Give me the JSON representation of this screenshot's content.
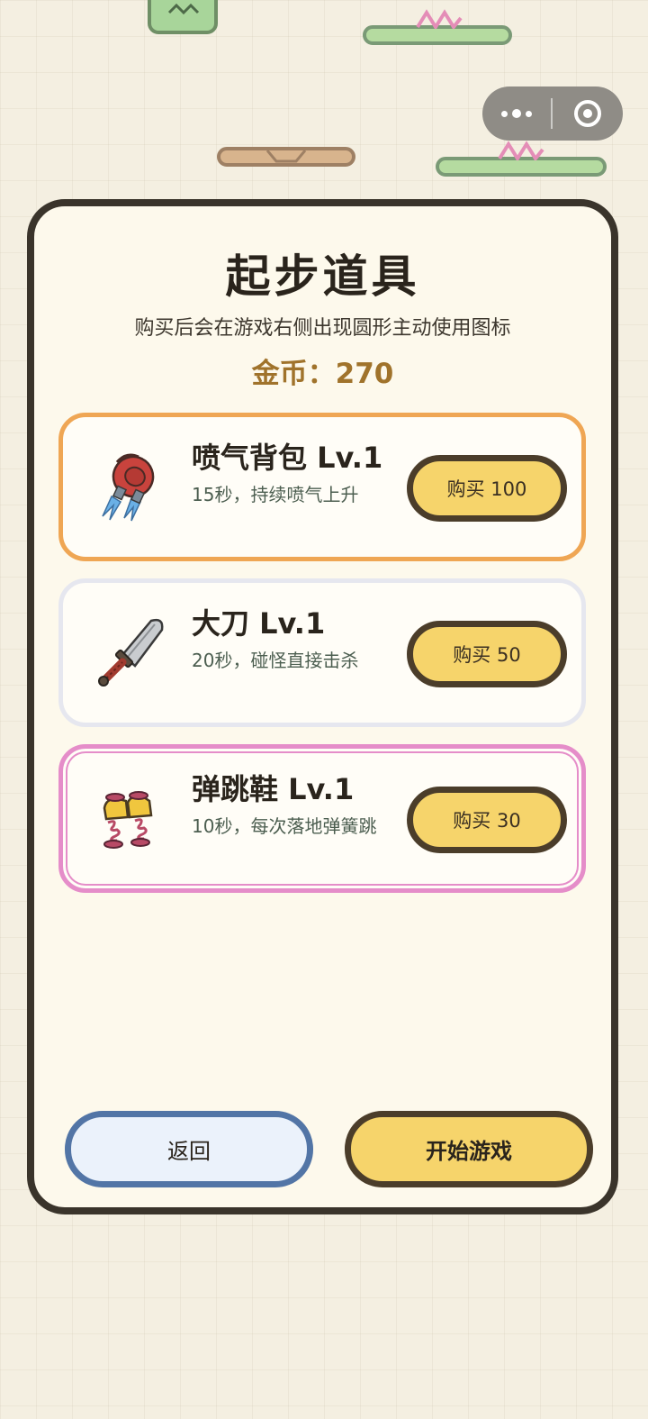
{
  "capsule": {
    "more_icon": "more-dots-icon",
    "close_icon": "target-circle-icon"
  },
  "dialog": {
    "title": "起步道具",
    "subtitle": "购买后会在游戏右侧出现圆形主动使用图标",
    "coins_label": "金币：270",
    "items": [
      {
        "name": "喷气背包 Lv.1",
        "desc": "15秒，持续喷气上升",
        "buy_label": "购买 100",
        "icon": "jetpack-icon",
        "border_color": "#efa654"
      },
      {
        "name": "大刀 Lv.1",
        "desc": "20秒，碰怪直接击杀",
        "buy_label": "购买 50",
        "icon": "broadsword-icon",
        "border_color": "#e6e7ef"
      },
      {
        "name": "弹跳鞋 Lv.1",
        "desc": "10秒，每次落地弹簧跳",
        "buy_label": "购买 30",
        "icon": "spring-shoes-icon",
        "border_color": "#e58dc9"
      }
    ],
    "back_label": "返回",
    "start_label": "开始游戏"
  },
  "colors": {
    "background": "#f4efe1",
    "panel": "#fdf9ec",
    "accent_yellow": "#f6d46b",
    "coin_text": "#a0732b"
  }
}
